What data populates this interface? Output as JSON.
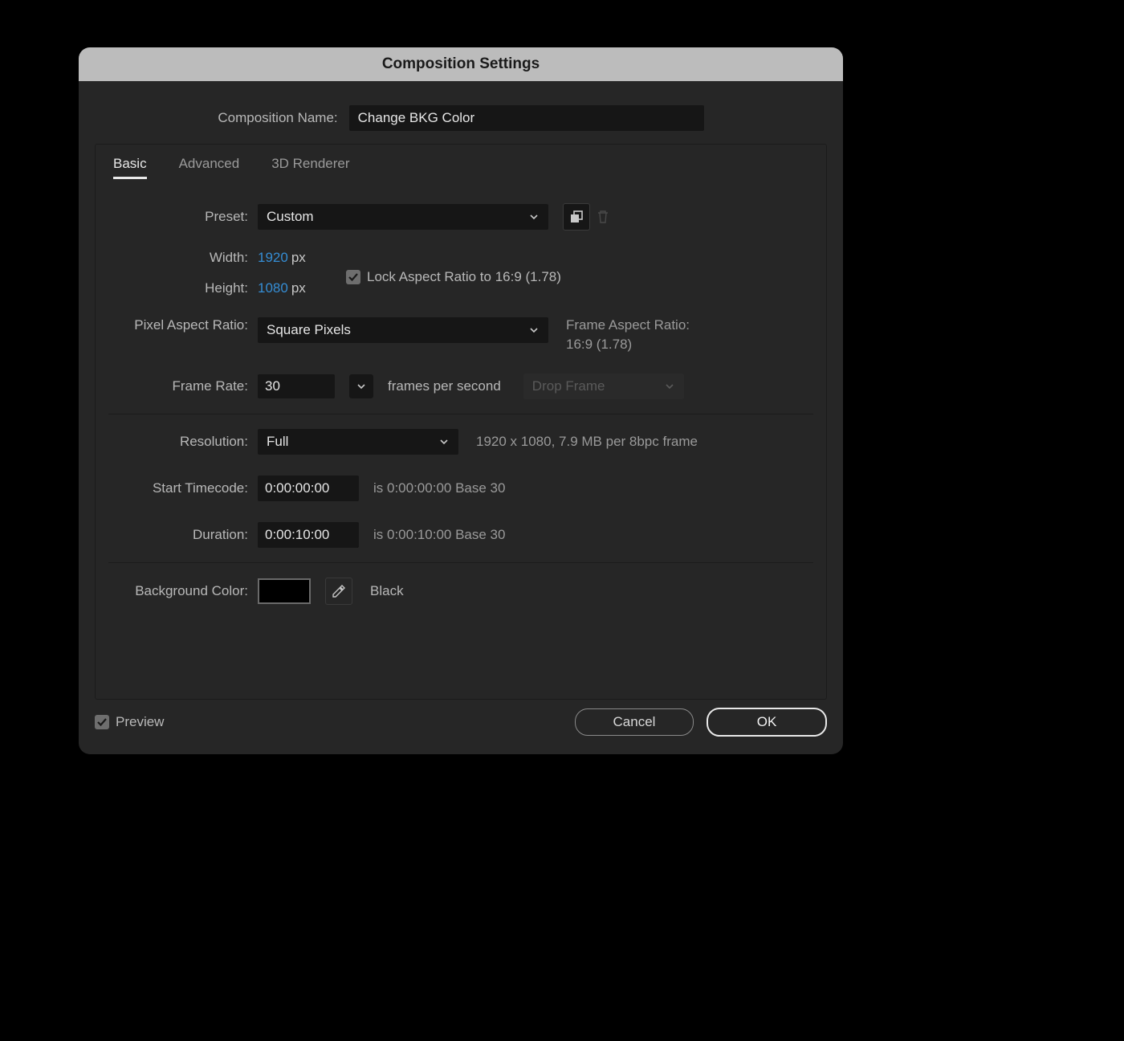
{
  "dialog": {
    "title": "Composition Settings",
    "name_label": "Composition Name:",
    "name_value": "Change BKG Color"
  },
  "tabs": {
    "basic": "Basic",
    "advanced": "Advanced",
    "renderer": "3D Renderer"
  },
  "preset": {
    "label": "Preset:",
    "value": "Custom"
  },
  "dimensions": {
    "width_label": "Width:",
    "width_value": "1920",
    "height_label": "Height:",
    "height_value": "1080",
    "unit": "px",
    "lock_label": "Lock Aspect Ratio to 16:9 (1.78)"
  },
  "par": {
    "label": "Pixel Aspect Ratio:",
    "value": "Square Pixels",
    "far_label": "Frame Aspect Ratio:",
    "far_value": "16:9 (1.78)"
  },
  "fr": {
    "label": "Frame Rate:",
    "value": "30",
    "fps_label": "frames per second",
    "drop": "Drop Frame"
  },
  "res": {
    "label": "Resolution:",
    "value": "Full",
    "info": "1920 x 1080, 7.9 MB per 8bpc frame"
  },
  "start": {
    "label": "Start Timecode:",
    "value": "0:00:00:00",
    "info": "is 0:00:00:00  Base 30"
  },
  "dur": {
    "label": "Duration:",
    "value": "0:00:10:00",
    "info": "is 0:00:10:00  Base 30"
  },
  "bg": {
    "label": "Background Color:",
    "name": "Black",
    "hex": "#000000"
  },
  "footer": {
    "preview": "Preview",
    "cancel": "Cancel",
    "ok": "OK"
  }
}
